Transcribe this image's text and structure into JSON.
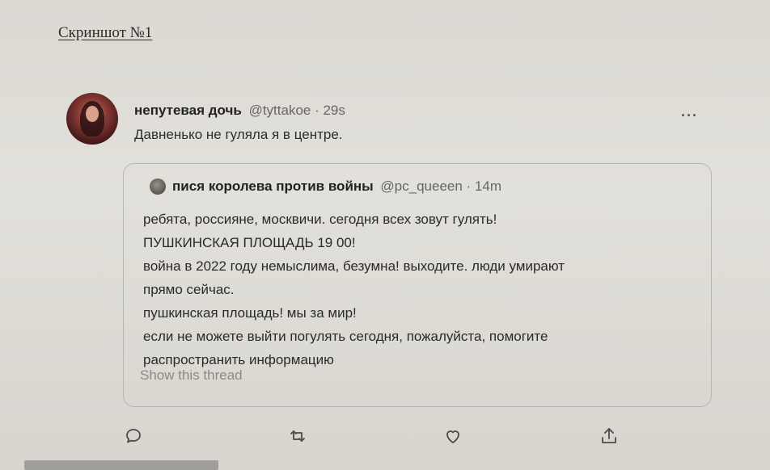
{
  "document": {
    "caption": "Скриншот №1"
  },
  "tweet": {
    "author_name": "непутевая дочь",
    "handle": "@tyttakoe · 29s",
    "text": "Давненько не гуляла я в центре.",
    "more_label": "···",
    "quote": {
      "author_name": "пися королева против войны",
      "handle": "@pc_queeen · 14m",
      "lines": [
        "ребята, россияне, москвичи. сегодня всех зовут гулять!",
        "ПУШКИНСКАЯ ПЛОЩАДЬ 19 00!",
        "война в 2022 году немыслима, безумна! выходите. люди умирают",
        "прямо сейчас.",
        "пушкинская площадь! мы за мир!",
        "если не можете выйти погулять сегодня, пожалуйста, помогите",
        "распространить информацию"
      ],
      "show_thread": "Show this thread"
    },
    "actions": [
      {
        "icon": "reply-icon"
      },
      {
        "icon": "retweet-icon"
      },
      {
        "icon": "like-icon"
      },
      {
        "icon": "share-icon"
      }
    ]
  },
  "colors": {
    "text": "#2a2a2a",
    "muted": "#666666",
    "link_muted": "#8a8a86",
    "border": "#b8b6b0"
  }
}
